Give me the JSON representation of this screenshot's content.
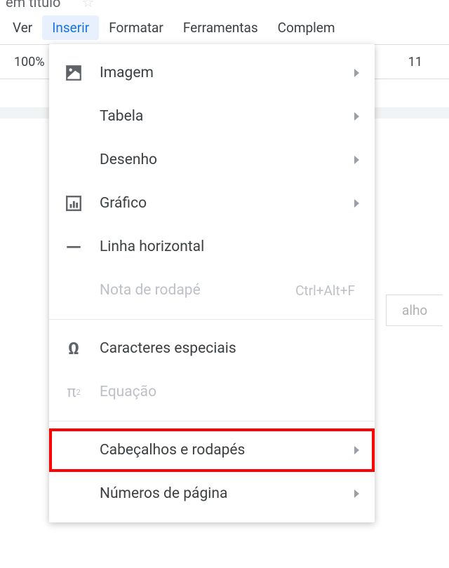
{
  "title_fragment": "em título",
  "menubar": {
    "items": [
      {
        "label": "Ver"
      },
      {
        "label": "Inserir",
        "active": true
      },
      {
        "label": "Formatar"
      },
      {
        "label": "Ferramentas"
      },
      {
        "label": "Complem"
      }
    ]
  },
  "toolbar": {
    "zoom": "100%",
    "font_size": "11"
  },
  "page_header_hint": "alho",
  "insert_menu": {
    "items": [
      {
        "label": "Imagem",
        "icon": "image-icon",
        "submenu": true,
        "disabled": false
      },
      {
        "label": "Tabela",
        "icon": "",
        "submenu": true,
        "disabled": false
      },
      {
        "label": "Desenho",
        "icon": "",
        "submenu": true,
        "disabled": false
      },
      {
        "label": "Gráfico",
        "icon": "chart-icon",
        "submenu": true,
        "disabled": false
      },
      {
        "label": "Linha horizontal",
        "icon": "hr-icon",
        "submenu": false,
        "disabled": false
      },
      {
        "label": "Nota de rodapé",
        "icon": "",
        "submenu": false,
        "disabled": true,
        "shortcut": "Ctrl+Alt+F"
      }
    ],
    "items2": [
      {
        "label": "Caracteres especiais",
        "icon": "omega-icon",
        "submenu": false,
        "disabled": false
      },
      {
        "label": "Equação",
        "icon": "pi-icon",
        "submenu": false,
        "disabled": true
      }
    ],
    "items3": [
      {
        "label": "Cabeçalhos e rodapés",
        "icon": "",
        "submenu": true,
        "disabled": false,
        "highlight": true
      },
      {
        "label": "Números de página",
        "icon": "",
        "submenu": true,
        "disabled": false
      }
    ]
  }
}
